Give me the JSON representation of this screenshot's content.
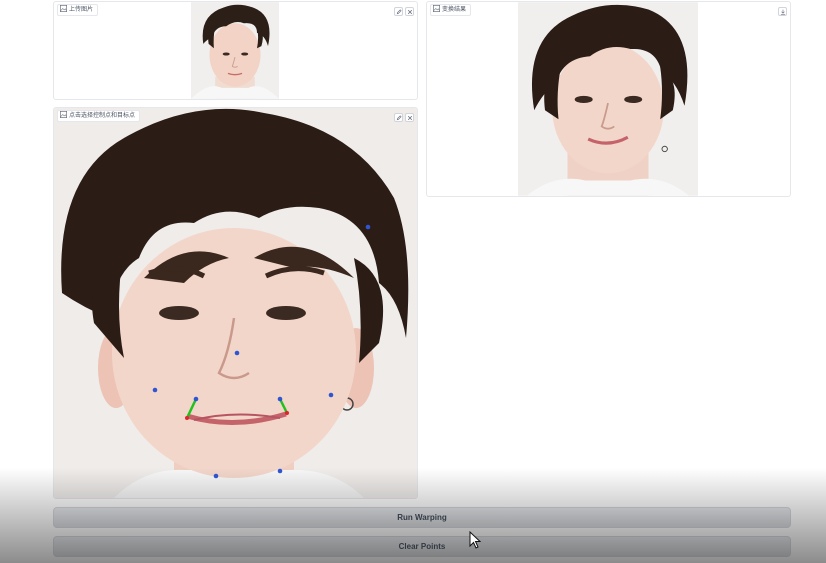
{
  "upload_panel": {
    "label": "上传图片",
    "icon": "image-icon"
  },
  "editor_panel": {
    "label": "点击选择控制点和目标点",
    "icon": "image-icon"
  },
  "result_panel": {
    "label": "变换结果",
    "icon": "image-icon"
  },
  "buttons": {
    "run_label": "Run Warping",
    "clear_label": "Clear Points"
  },
  "colors": {
    "control_point": "#2f55d4",
    "target_point": "#e0242b",
    "warp_line": "#22c21e"
  }
}
